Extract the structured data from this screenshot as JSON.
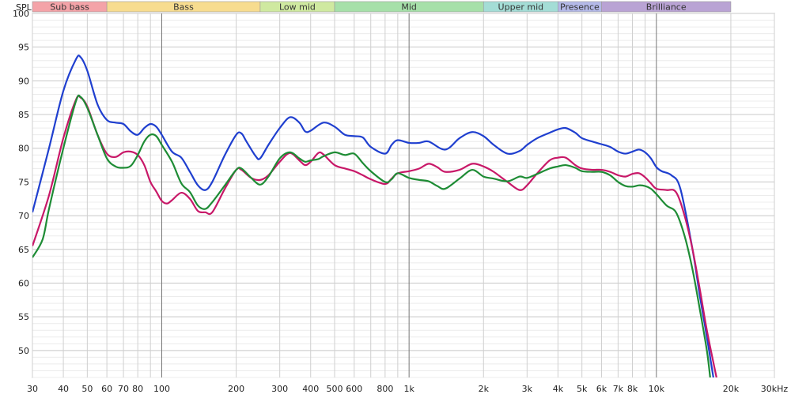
{
  "chart_data": {
    "type": "line",
    "title": "",
    "ylabel": "SPL",
    "xlabel": "",
    "x_scale": "log",
    "xlim": [
      30,
      30000
    ],
    "ylim": [
      46,
      100
    ],
    "grid": true,
    "y_ticks": [
      100,
      95,
      90,
      85,
      80,
      75,
      70,
      65,
      60,
      55,
      50
    ],
    "x_ticks": [
      {
        "v": 30,
        "label": "30"
      },
      {
        "v": 40,
        "label": "40"
      },
      {
        "v": 50,
        "label": "50"
      },
      {
        "v": 60,
        "label": "60"
      },
      {
        "v": 70,
        "label": "70"
      },
      {
        "v": 80,
        "label": "80"
      },
      {
        "v": 100,
        "label": "100"
      },
      {
        "v": 200,
        "label": "200"
      },
      {
        "v": 300,
        "label": "300"
      },
      {
        "v": 400,
        "label": "400"
      },
      {
        "v": 500,
        "label": "500"
      },
      {
        "v": 600,
        "label": "600"
      },
      {
        "v": 800,
        "label": "800"
      },
      {
        "v": 1000,
        "label": "1k"
      },
      {
        "v": 2000,
        "label": "2k"
      },
      {
        "v": 3000,
        "label": "3k"
      },
      {
        "v": 4000,
        "label": "4k"
      },
      {
        "v": 5000,
        "label": "5k"
      },
      {
        "v": 6000,
        "label": "6k"
      },
      {
        "v": 7000,
        "label": "7k"
      },
      {
        "v": 8000,
        "label": "8k"
      },
      {
        "v": 10000,
        "label": "10k"
      },
      {
        "v": 20000,
        "label": "20k"
      },
      {
        "v": 30000,
        "label": "30kHz"
      }
    ],
    "bands": [
      {
        "name": "Sub bass",
        "from": 30,
        "to": 60,
        "color": "#f4a3a8"
      },
      {
        "name": "Bass",
        "from": 60,
        "to": 250,
        "color": "#f7dc8f"
      },
      {
        "name": "Low mid",
        "from": 250,
        "to": 500,
        "color": "#cfe9a0"
      },
      {
        "name": "Mid",
        "from": 500,
        "to": 2000,
        "color": "#a6e0a9"
      },
      {
        "name": "Upper mid",
        "from": 2000,
        "to": 4000,
        "color": "#a4ddd6"
      },
      {
        "name": "Presence",
        "from": 4000,
        "to": 6000,
        "color": "#b4b9e8"
      },
      {
        "name": "Brilliance",
        "from": 6000,
        "to": 20000,
        "color": "#b9a3d4"
      }
    ],
    "series": [
      {
        "color": "#1f3fcf",
        "points": [
          [
            30,
            70.5
          ],
          [
            35,
            80
          ],
          [
            40,
            88.5
          ],
          [
            45,
            93.2
          ],
          [
            47,
            93.5
          ],
          [
            50,
            91.5
          ],
          [
            55,
            86.5
          ],
          [
            60,
            84.2
          ],
          [
            65,
            83.8
          ],
          [
            70,
            83.6
          ],
          [
            75,
            82.5
          ],
          [
            80,
            82
          ],
          [
            85,
            83
          ],
          [
            90,
            83.6
          ],
          [
            95,
            83.2
          ],
          [
            100,
            82
          ],
          [
            110,
            79.5
          ],
          [
            120,
            78.6
          ],
          [
            130,
            76.5
          ],
          [
            140,
            74.5
          ],
          [
            150,
            73.8
          ],
          [
            160,
            75
          ],
          [
            180,
            79
          ],
          [
            200,
            82
          ],
          [
            210,
            82.2
          ],
          [
            220,
            81
          ],
          [
            240,
            78.8
          ],
          [
            250,
            78.5
          ],
          [
            270,
            80.5
          ],
          [
            300,
            83
          ],
          [
            330,
            84.6
          ],
          [
            360,
            83.8
          ],
          [
            380,
            82.5
          ],
          [
            400,
            82.6
          ],
          [
            450,
            83.8
          ],
          [
            500,
            83.2
          ],
          [
            550,
            82
          ],
          [
            600,
            81.8
          ],
          [
            650,
            81.6
          ],
          [
            700,
            80.2
          ],
          [
            800,
            79.2
          ],
          [
            850,
            80.5
          ],
          [
            900,
            81.2
          ],
          [
            1000,
            80.8
          ],
          [
            1100,
            80.8
          ],
          [
            1200,
            81
          ],
          [
            1400,
            79.8
          ],
          [
            1600,
            81.5
          ],
          [
            1800,
            82.4
          ],
          [
            2000,
            81.8
          ],
          [
            2200,
            80.5
          ],
          [
            2500,
            79.2
          ],
          [
            2800,
            79.6
          ],
          [
            3000,
            80.5
          ],
          [
            3300,
            81.5
          ],
          [
            3700,
            82.3
          ],
          [
            4000,
            82.8
          ],
          [
            4300,
            83
          ],
          [
            4700,
            82.3
          ],
          [
            5000,
            81.5
          ],
          [
            5500,
            81
          ],
          [
            6000,
            80.6
          ],
          [
            6500,
            80.2
          ],
          [
            7000,
            79.5
          ],
          [
            7500,
            79.2
          ],
          [
            8000,
            79.5
          ],
          [
            8500,
            79.8
          ],
          [
            9000,
            79.4
          ],
          [
            9500,
            78.5
          ],
          [
            10000,
            77.2
          ],
          [
            10500,
            76.6
          ],
          [
            11500,
            76
          ],
          [
            12500,
            74
          ],
          [
            14000,
            65
          ],
          [
            15000,
            58
          ],
          [
            16000,
            52
          ],
          [
            17000,
            46
          ]
        ]
      },
      {
        "color": "#c81868",
        "points": [
          [
            30,
            65.5
          ],
          [
            35,
            73
          ],
          [
            40,
            81.5
          ],
          [
            45,
            87.2
          ],
          [
            47,
            87.5
          ],
          [
            50,
            86.2
          ],
          [
            55,
            82
          ],
          [
            60,
            79.2
          ],
          [
            65,
            78.7
          ],
          [
            70,
            79.4
          ],
          [
            75,
            79.5
          ],
          [
            80,
            79
          ],
          [
            85,
            77.5
          ],
          [
            90,
            75
          ],
          [
            95,
            73.6
          ],
          [
            100,
            72.2
          ],
          [
            105,
            71.8
          ],
          [
            110,
            72.3
          ],
          [
            120,
            73.4
          ],
          [
            130,
            72.5
          ],
          [
            140,
            70.7
          ],
          [
            150,
            70.5
          ],
          [
            160,
            70.5
          ],
          [
            180,
            74
          ],
          [
            200,
            76.8
          ],
          [
            210,
            76.8
          ],
          [
            230,
            75.6
          ],
          [
            250,
            75.3
          ],
          [
            270,
            76
          ],
          [
            300,
            78
          ],
          [
            330,
            79.3
          ],
          [
            360,
            78.2
          ],
          [
            380,
            77.5
          ],
          [
            400,
            78
          ],
          [
            430,
            79.3
          ],
          [
            450,
            79.1
          ],
          [
            500,
            77.5
          ],
          [
            550,
            77
          ],
          [
            600,
            76.6
          ],
          [
            650,
            76
          ],
          [
            700,
            75.4
          ],
          [
            800,
            74.7
          ],
          [
            850,
            75.5
          ],
          [
            900,
            76.3
          ],
          [
            1000,
            76.6
          ],
          [
            1100,
            77
          ],
          [
            1200,
            77.7
          ],
          [
            1300,
            77.2
          ],
          [
            1400,
            76.5
          ],
          [
            1600,
            76.8
          ],
          [
            1800,
            77.7
          ],
          [
            2000,
            77.3
          ],
          [
            2200,
            76.5
          ],
          [
            2500,
            75
          ],
          [
            2800,
            73.8
          ],
          [
            3000,
            74.5
          ],
          [
            3300,
            76.3
          ],
          [
            3700,
            78.2
          ],
          [
            4000,
            78.6
          ],
          [
            4300,
            78.6
          ],
          [
            4700,
            77.5
          ],
          [
            5000,
            77
          ],
          [
            5500,
            76.8
          ],
          [
            6000,
            76.8
          ],
          [
            6500,
            76.5
          ],
          [
            7000,
            76
          ],
          [
            7500,
            75.8
          ],
          [
            8000,
            76.2
          ],
          [
            8500,
            76.3
          ],
          [
            9000,
            75.7
          ],
          [
            9500,
            74.8
          ],
          [
            10000,
            74
          ],
          [
            11000,
            73.8
          ],
          [
            12000,
            73.5
          ],
          [
            13000,
            70
          ],
          [
            14000,
            65
          ],
          [
            15000,
            59
          ],
          [
            16000,
            53
          ],
          [
            17500,
            46
          ]
        ]
      },
      {
        "color": "#1e8c35",
        "points": [
          [
            30,
            63.8
          ],
          [
            33,
            66.5
          ],
          [
            35,
            71
          ],
          [
            40,
            80
          ],
          [
            45,
            87
          ],
          [
            47,
            87.6
          ],
          [
            50,
            86
          ],
          [
            55,
            82
          ],
          [
            60,
            78.5
          ],
          [
            65,
            77.3
          ],
          [
            70,
            77.1
          ],
          [
            75,
            77.4
          ],
          [
            80,
            79
          ],
          [
            85,
            81
          ],
          [
            90,
            82
          ],
          [
            95,
            81.8
          ],
          [
            100,
            80.5
          ],
          [
            110,
            78
          ],
          [
            120,
            74.8
          ],
          [
            130,
            73.5
          ],
          [
            140,
            71.5
          ],
          [
            150,
            71
          ],
          [
            160,
            72
          ],
          [
            180,
            74.5
          ],
          [
            200,
            76.8
          ],
          [
            210,
            77
          ],
          [
            230,
            75.6
          ],
          [
            250,
            74.6
          ],
          [
            270,
            75.8
          ],
          [
            300,
            78.5
          ],
          [
            330,
            79.4
          ],
          [
            360,
            78.5
          ],
          [
            380,
            78
          ],
          [
            400,
            78.2
          ],
          [
            430,
            78.4
          ],
          [
            450,
            78.8
          ],
          [
            500,
            79.4
          ],
          [
            550,
            79
          ],
          [
            600,
            79.2
          ],
          [
            650,
            77.8
          ],
          [
            700,
            76.6
          ],
          [
            800,
            75
          ],
          [
            850,
            75.4
          ],
          [
            900,
            76.3
          ],
          [
            1000,
            75.6
          ],
          [
            1100,
            75.3
          ],
          [
            1200,
            75.1
          ],
          [
            1300,
            74.4
          ],
          [
            1400,
            74
          ],
          [
            1600,
            75.5
          ],
          [
            1800,
            76.8
          ],
          [
            2000,
            75.8
          ],
          [
            2200,
            75.5
          ],
          [
            2500,
            75.1
          ],
          [
            2800,
            75.8
          ],
          [
            3000,
            75.6
          ],
          [
            3300,
            76.2
          ],
          [
            3700,
            77
          ],
          [
            4000,
            77.3
          ],
          [
            4300,
            77.5
          ],
          [
            4700,
            77.1
          ],
          [
            5000,
            76.6
          ],
          [
            5500,
            76.5
          ],
          [
            6000,
            76.5
          ],
          [
            6500,
            76
          ],
          [
            7000,
            75
          ],
          [
            7500,
            74.4
          ],
          [
            8000,
            74.3
          ],
          [
            8500,
            74.5
          ],
          [
            9000,
            74.4
          ],
          [
            9500,
            74
          ],
          [
            10000,
            73.2
          ],
          [
            11000,
            71.5
          ],
          [
            12000,
            70.5
          ],
          [
            13000,
            67
          ],
          [
            14000,
            62
          ],
          [
            15000,
            56
          ],
          [
            16000,
            50
          ],
          [
            16500,
            46
          ]
        ]
      }
    ]
  }
}
